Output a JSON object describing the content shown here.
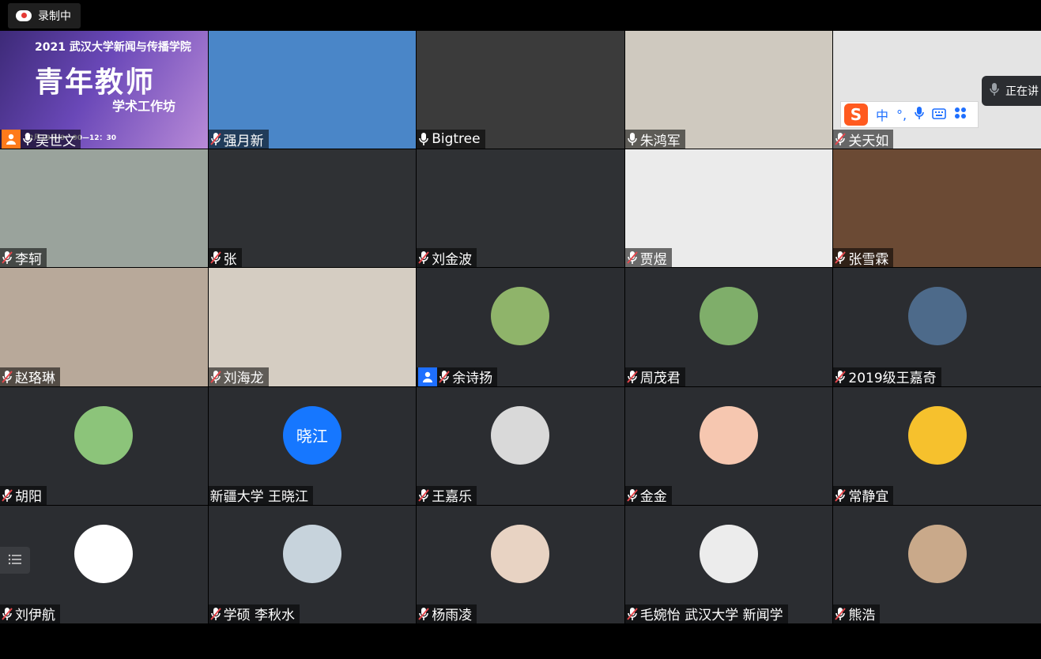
{
  "recording": {
    "label": "录制中"
  },
  "speaking": {
    "label": "正在讲"
  },
  "ime": {
    "lang": "中",
    "punct": "°,"
  },
  "poster": {
    "title": "2021 武汉大学新闻与传播学院",
    "big": "青年教师",
    "sub": "学术工作坊",
    "date": "12月19日 9：00—12：30"
  },
  "participants": [
    {
      "name": "吴世文",
      "mic": "on",
      "role": "host",
      "kind": "video",
      "bg": "#5a3c8c"
    },
    {
      "name": "强月新",
      "mic": "muted",
      "kind": "video",
      "bg": "#4a86c8"
    },
    {
      "name": "Bigtree",
      "mic": "on",
      "kind": "video",
      "bg": "#3b3b3b"
    },
    {
      "name": "朱鸿军",
      "mic": "on",
      "kind": "video",
      "bg": "#cfc9bf"
    },
    {
      "name": "关天如",
      "mic": "muted",
      "kind": "video",
      "bg": "#e4e4e4"
    },
    {
      "name": "李轲",
      "mic": "muted",
      "kind": "video",
      "bg": "#9aa39c"
    },
    {
      "name": "张",
      "mic": "muted",
      "kind": "video",
      "bg": "#2f3134"
    },
    {
      "name": "刘金波",
      "mic": "muted",
      "kind": "video",
      "bg": "#2f3134"
    },
    {
      "name": "贾煜",
      "mic": "muted",
      "kind": "video",
      "bg": "#ebebeb"
    },
    {
      "name": "张雪霖",
      "mic": "muted",
      "kind": "video",
      "bg": "#6b4a34"
    },
    {
      "name": "赵珞琳",
      "mic": "muted",
      "kind": "video",
      "bg": "#b8a99a"
    },
    {
      "name": "刘海龙",
      "mic": "muted",
      "kind": "video",
      "bg": "#d5cdc2"
    },
    {
      "name": "余诗扬",
      "mic": "muted",
      "role": "cohost",
      "kind": "avatar",
      "avatar": "#8fb46a"
    },
    {
      "name": "周茂君",
      "mic": "muted",
      "kind": "avatar",
      "avatar": "#7fae6a"
    },
    {
      "name": "2019级王嘉奇",
      "mic": "muted",
      "kind": "avatar",
      "avatar": "#4d6a8a"
    },
    {
      "name": "胡阳",
      "mic": "muted",
      "kind": "avatar",
      "avatar": "#8cc47a"
    },
    {
      "name": "新疆大学 王晓江",
      "mic": "none",
      "kind": "text-avatar",
      "initials": "晓江"
    },
    {
      "name": "王嘉乐",
      "mic": "muted",
      "kind": "avatar",
      "avatar": "#d9d9d9"
    },
    {
      "name": "金金",
      "mic": "muted",
      "kind": "avatar",
      "avatar": "#f6c7b0"
    },
    {
      "name": "常静宜",
      "mic": "muted",
      "kind": "avatar",
      "avatar": "#f6c12d"
    },
    {
      "name": "刘伊航",
      "mic": "muted",
      "kind": "avatar",
      "avatar": "#ffffff"
    },
    {
      "name": "学硕 李秋水",
      "mic": "muted",
      "kind": "avatar",
      "avatar": "#c7d3dc"
    },
    {
      "name": "杨雨凌",
      "mic": "muted",
      "kind": "avatar",
      "avatar": "#e8d3c3"
    },
    {
      "name": "毛婉怡 武汉大学 新闻学",
      "mic": "muted",
      "kind": "avatar",
      "avatar": "#ececec"
    },
    {
      "name": "熊浩",
      "mic": "muted",
      "kind": "avatar",
      "avatar": "#c9a98a"
    }
  ],
  "colors": {
    "host": "#ff7a1a",
    "cohost": "#1e6fff",
    "muted": "#e5484d",
    "tile": "#2b2d31"
  }
}
